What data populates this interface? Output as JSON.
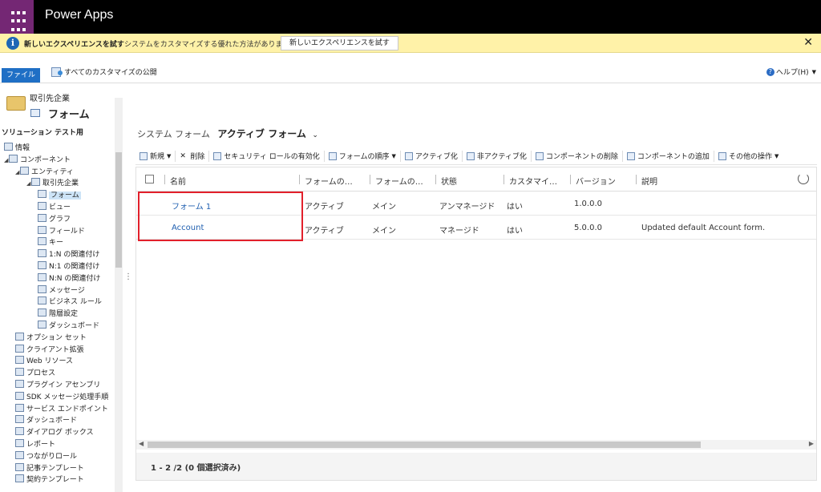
{
  "app": {
    "title": "Power Apps"
  },
  "notice": {
    "title": "新しいエクスペリエンスを試す",
    "text": "システムをカスタマイズする優れた方法があります",
    "button": "新しいエクスペリエンスを試す",
    "close": "✕"
  },
  "ribbon": {
    "file_tab": "ファイル",
    "publish": "すべてのカスタマイズの公開",
    "help": "ヘルプ(H)"
  },
  "leftnav": {
    "entity": "取引先企業",
    "section": "フォーム",
    "solution": "ソリューション テスト用",
    "items": [
      {
        "label": "情報",
        "indent": 0
      },
      {
        "label": "コンポーネント",
        "indent": 0
      },
      {
        "label": "エンティティ",
        "indent": 1
      },
      {
        "label": "取引先企業",
        "indent": 2
      },
      {
        "label": "フォーム",
        "indent": 3,
        "selected": true
      },
      {
        "label": "ビュー",
        "indent": 3
      },
      {
        "label": "グラフ",
        "indent": 3
      },
      {
        "label": "フィールド",
        "indent": 3
      },
      {
        "label": "キー",
        "indent": 3
      },
      {
        "label": "1:N の関連付け",
        "indent": 3
      },
      {
        "label": "N:1 の関連付け",
        "indent": 3
      },
      {
        "label": "N:N の関連付け",
        "indent": 3
      },
      {
        "label": "メッセージ",
        "indent": 3
      },
      {
        "label": "ビジネス ルール",
        "indent": 3
      },
      {
        "label": "階層設定",
        "indent": 3
      },
      {
        "label": "ダッシュボード",
        "indent": 3
      },
      {
        "label": "オプション セット",
        "indent": 1
      },
      {
        "label": "クライアント拡張",
        "indent": 1
      },
      {
        "label": "Web リソース",
        "indent": 1
      },
      {
        "label": "プロセス",
        "indent": 1
      },
      {
        "label": "プラグイン アセンブリ",
        "indent": 1
      },
      {
        "label": "SDK メッセージ処理手順",
        "indent": 1
      },
      {
        "label": "サービス エンドポイント",
        "indent": 1
      },
      {
        "label": "ダッシュボード",
        "indent": 1
      },
      {
        "label": "ダイアログ ボックス",
        "indent": 1
      },
      {
        "label": "レポート",
        "indent": 1
      },
      {
        "label": "つながりロール",
        "indent": 1
      },
      {
        "label": "記事テンプレート",
        "indent": 1
      },
      {
        "label": "契約テンプレート",
        "indent": 1
      }
    ]
  },
  "view": {
    "system_label": "システム フォーム",
    "active_label": "アクティブ フォーム"
  },
  "toolbar": [
    "新規",
    "削除",
    "セキュリティ ロールの有効化",
    "フォームの順序",
    "アクティブ化",
    "非アクティブ化",
    "コンポーネントの削除",
    "コンポーネントの追加",
    "その他の操作"
  ],
  "grid": {
    "columns": [
      "名前",
      "フォームの…",
      "フォームの…",
      "状態",
      "カスタマイ…",
      "バージョン",
      "説明"
    ],
    "rows": [
      [
        "フォーム 1",
        "アクティブ",
        "メイン",
        "アンマネージド",
        "はい",
        "1.0.0.0",
        ""
      ],
      [
        "Account",
        "アクティブ",
        "メイン",
        "マネージド",
        "はい",
        "5.0.0.0",
        "Updated default Account form."
      ]
    ],
    "footer": "1 - 2 /2 (0 個選択済み)"
  }
}
